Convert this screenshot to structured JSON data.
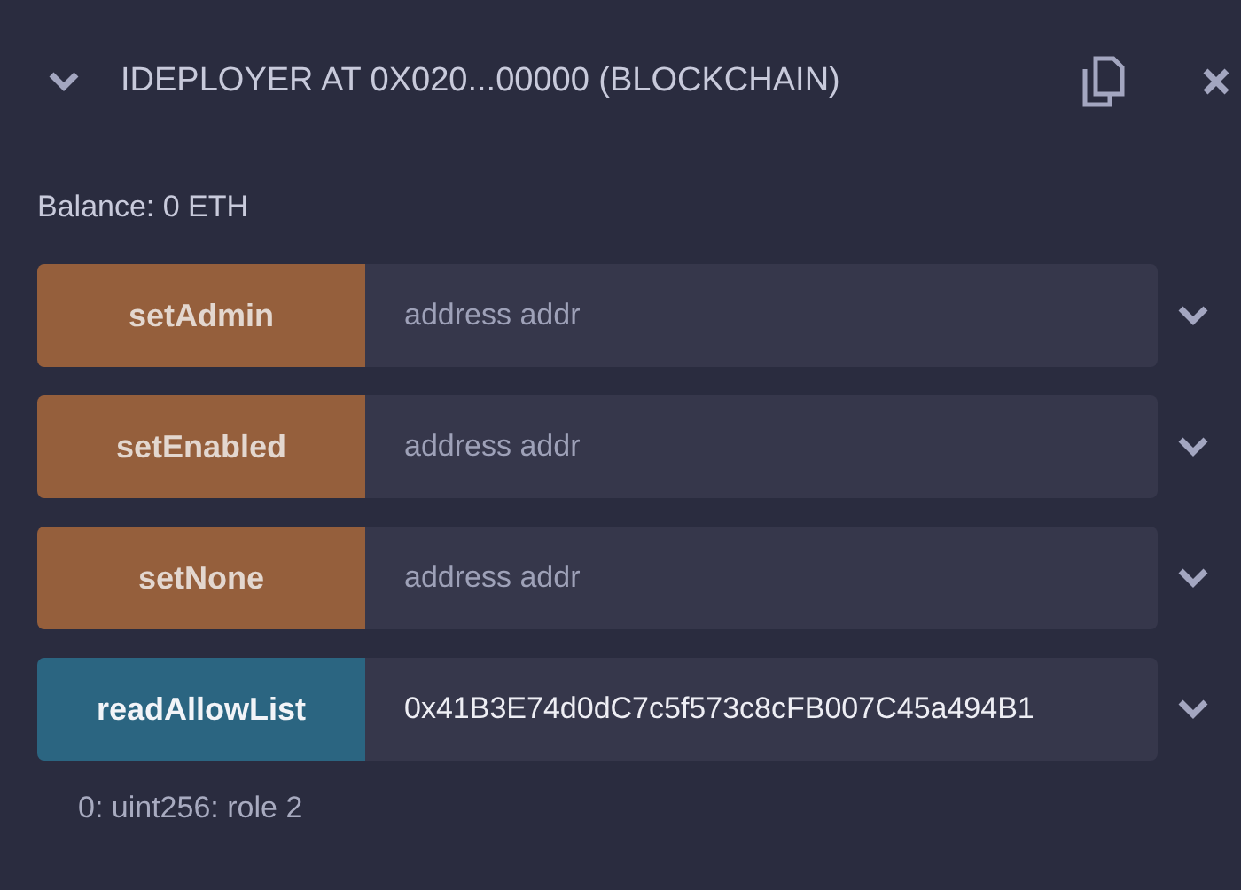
{
  "header": {
    "expanded": true,
    "title": "IDEPLOYER AT 0X020...00000 (BLOCKCHAIN)"
  },
  "balance": "Balance: 0 ETH",
  "functions": [
    {
      "name": "setAdmin",
      "kind": "transact",
      "placeholder": "address addr"
    },
    {
      "name": "setEnabled",
      "kind": "transact",
      "placeholder": "address addr"
    },
    {
      "name": "setNone",
      "kind": "transact",
      "placeholder": "address addr"
    },
    {
      "name": "readAllowList",
      "kind": "call",
      "value": "0x41B3E74d0dC7c5f573c8cFB007C45a494B1"
    }
  ],
  "output": "0: uint256: role 2"
}
